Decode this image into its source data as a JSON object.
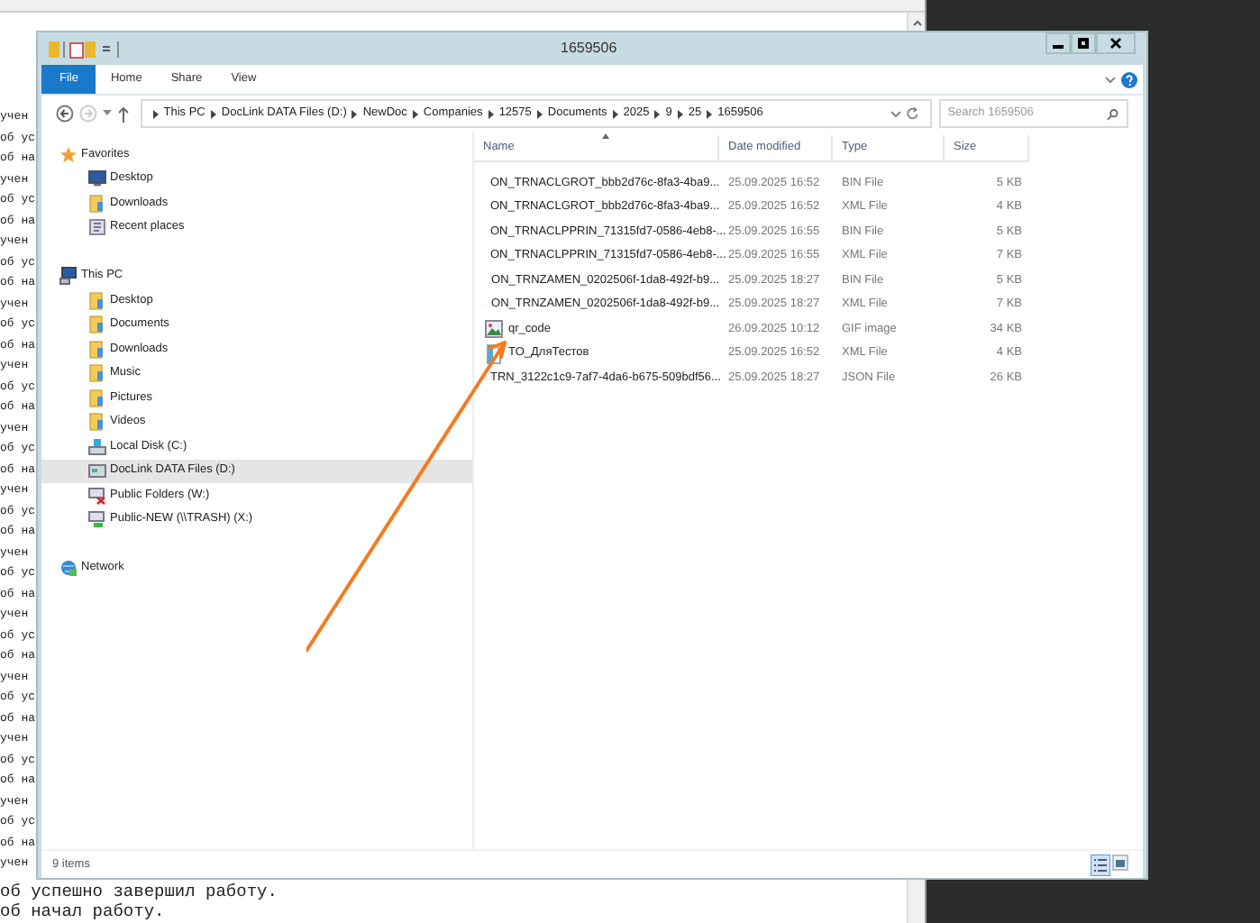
{
  "console": {
    "lines": [
      "учен",
      "об ус",
      "об на",
      "учен",
      "об ус",
      "об на",
      "учен",
      "об ус",
      "об на",
      "учен",
      "об ус",
      "об на",
      "учен",
      "об ус",
      "об на",
      "учен",
      "об ус",
      "об на",
      "учен",
      "об ус",
      "об на",
      "учен",
      "об ус",
      "об на",
      "учен",
      "об ус",
      "об на",
      "учен",
      "об ус",
      "об на",
      "учен",
      "об ус",
      "об на",
      "учен",
      "об ус",
      "об на",
      "учен",
      "об успешно завершил работу.",
      "об начал работу."
    ]
  },
  "window": {
    "title": "1659506"
  },
  "ribbon_tabs": [
    {
      "label": "File",
      "selected": true
    },
    {
      "label": "Home",
      "selected": false
    },
    {
      "label": "Share",
      "selected": false
    },
    {
      "label": "View",
      "selected": false
    }
  ],
  "address": {
    "crumbs": [
      "This PC",
      "DocLink DATA Files (D:)",
      "NewDoc",
      "Companies",
      "12575",
      "Documents",
      "2025",
      "9",
      "25",
      "1659506"
    ]
  },
  "search": {
    "placeholder": "Search 1659506"
  },
  "nav": [
    {
      "label": "Favorites",
      "kind": "favorites",
      "selected": false,
      "children": [
        {
          "label": "Desktop",
          "kind": "desktop",
          "selected": false
        },
        {
          "label": "Downloads",
          "kind": "folder",
          "selected": false
        },
        {
          "label": "Recent places",
          "kind": "recent",
          "selected": false
        }
      ]
    },
    {
      "label": "This PC",
      "kind": "pc",
      "selected": false,
      "children": [
        {
          "label": "Desktop",
          "kind": "folder",
          "selected": false
        },
        {
          "label": "Documents",
          "kind": "folder",
          "selected": false
        },
        {
          "label": "Downloads",
          "kind": "folder",
          "selected": false
        },
        {
          "label": "Music",
          "kind": "folder",
          "selected": false
        },
        {
          "label": "Pictures",
          "kind": "folder",
          "selected": false
        },
        {
          "label": "Videos",
          "kind": "folder",
          "selected": false
        },
        {
          "label": "Local Disk (C:)",
          "kind": "disk",
          "selected": false
        },
        {
          "label": "DocLink DATA Files (D:)",
          "kind": "drive",
          "selected": true
        },
        {
          "label": "Public Folders (W:)",
          "kind": "netfail",
          "selected": false
        },
        {
          "label": "Public-NEW (\\\\TRASH) (X:)",
          "kind": "netok",
          "selected": false
        }
      ]
    },
    {
      "label": "Network",
      "kind": "network",
      "selected": false
    }
  ],
  "table": {
    "columns": [
      "Name",
      "Date modified",
      "Type",
      "Size"
    ],
    "rows": [
      {
        "name": "ON_TRNACLGROT_bbb2d76c-8fa3-4ba9...",
        "date": "25.09.2025 16:52",
        "type": "BIN File",
        "size": "5 KB",
        "kind": "blank"
      },
      {
        "name": "ON_TRNACLGROT_bbb2d76c-8fa3-4ba9...",
        "date": "25.09.2025 16:52",
        "type": "XML File",
        "size": "4 KB",
        "kind": "xml"
      },
      {
        "name": "ON_TRNACLPPRIN_71315fd7-0586-4eb8-...",
        "date": "25.09.2025 16:55",
        "type": "BIN File",
        "size": "5 KB",
        "kind": "blank"
      },
      {
        "name": "ON_TRNACLPPRIN_71315fd7-0586-4eb8-...",
        "date": "25.09.2025 16:55",
        "type": "XML File",
        "size": "7 KB",
        "kind": "xml"
      },
      {
        "name": "ON_TRNZAMEN_0202506f-1da8-492f-b9...",
        "date": "25.09.2025 18:27",
        "type": "BIN File",
        "size": "5 KB",
        "kind": "blank"
      },
      {
        "name": "ON_TRNZAMEN_0202506f-1da8-492f-b9...",
        "date": "25.09.2025 18:27",
        "type": "XML File",
        "size": "7 KB",
        "kind": "xml"
      },
      {
        "name": "qr_code",
        "date": "26.09.2025 10:12",
        "type": "GIF image",
        "size": "34 KB",
        "kind": "image"
      },
      {
        "name": "TO_ДляТестов",
        "date": "25.09.2025 16:52",
        "type": "XML File",
        "size": "4 KB",
        "kind": "xml"
      },
      {
        "name": "TRN_3122c1c9-7af7-4da6-b675-509bdf56...",
        "date": "25.09.2025 18:27",
        "type": "JSON File",
        "size": "26 KB",
        "kind": "blank"
      }
    ]
  },
  "status_bar": {
    "count": "9 items"
  }
}
